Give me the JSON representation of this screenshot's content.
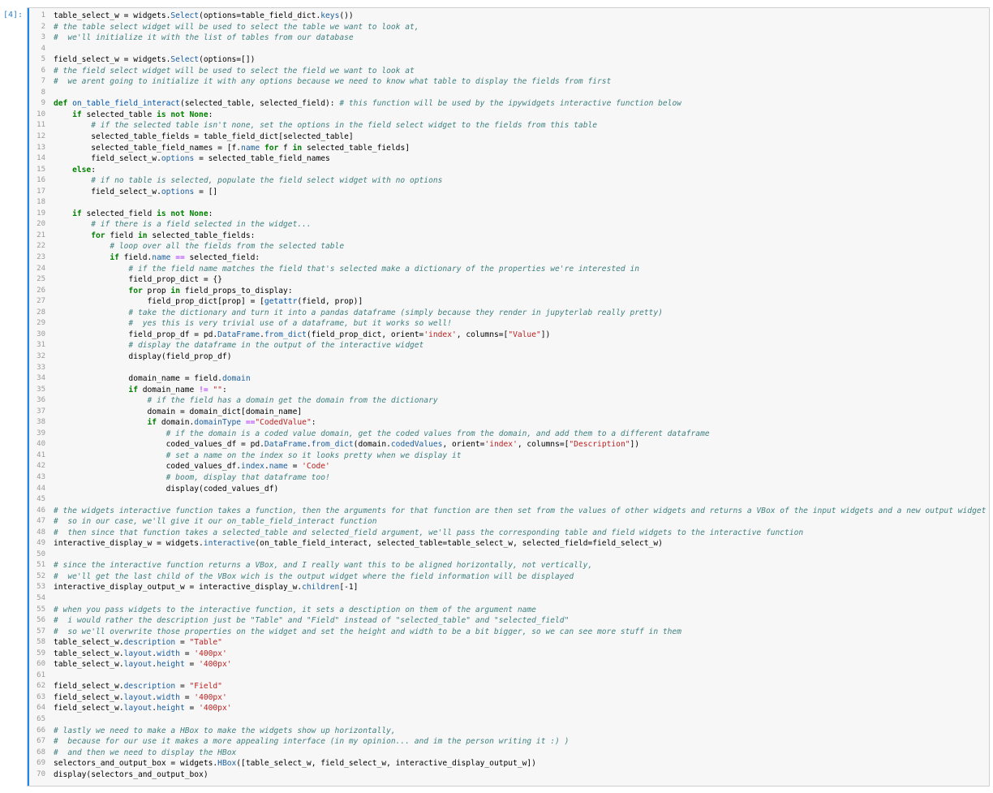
{
  "prompt": "[4]:",
  "lines": [
    [
      [
        "n",
        "table_select_w = widgets."
      ],
      [
        "at",
        "Select"
      ],
      [
        "n",
        "(options=table_field_dict."
      ],
      [
        "at",
        "keys"
      ],
      [
        "n",
        "())"
      ]
    ],
    [
      [
        "cm",
        "# the table select widget will be used to select the table we want to look at,"
      ]
    ],
    [
      [
        "cm",
        "#  we'll initialize it with the list of tables from our database"
      ]
    ],
    [
      [
        "n",
        ""
      ]
    ],
    [
      [
        "n",
        "field_select_w = widgets."
      ],
      [
        "at",
        "Select"
      ],
      [
        "n",
        "(options=[])"
      ]
    ],
    [
      [
        "cm",
        "# the field select widget will be used to select the field we want to look at"
      ]
    ],
    [
      [
        "cm",
        "#  we arent going to initialize it with any options because we need to know what table to display the fields from first"
      ]
    ],
    [
      [
        "n",
        ""
      ]
    ],
    [
      [
        "kw",
        "def "
      ],
      [
        "nb",
        "on_table_field_interact"
      ],
      [
        "n",
        "(selected_table, selected_field): "
      ],
      [
        "cm",
        "# this function will be used by the ipywidgets interactive function below"
      ]
    ],
    [
      [
        "n",
        "    "
      ],
      [
        "kw",
        "if "
      ],
      [
        "n",
        "selected_table "
      ],
      [
        "kw",
        "is not None"
      ],
      [
        "n",
        ":"
      ]
    ],
    [
      [
        "n",
        "        "
      ],
      [
        "cm",
        "# if the selected table isn't none, set the options in the field select widget to the fields from this table"
      ]
    ],
    [
      [
        "n",
        "        selected_table_fields = table_field_dict[selected_table]"
      ]
    ],
    [
      [
        "n",
        "        selected_table_field_names = [f."
      ],
      [
        "at",
        "name"
      ],
      [
        "n",
        " "
      ],
      [
        "kw",
        "for "
      ],
      [
        "n",
        "f "
      ],
      [
        "kw",
        "in "
      ],
      [
        "n",
        "selected_table_fields]"
      ]
    ],
    [
      [
        "n",
        "        field_select_w."
      ],
      [
        "at",
        "options"
      ],
      [
        "n",
        " = selected_table_field_names"
      ]
    ],
    [
      [
        "n",
        "    "
      ],
      [
        "kw",
        "else"
      ],
      [
        "n",
        ":"
      ]
    ],
    [
      [
        "n",
        "        "
      ],
      [
        "cm",
        "# if no table is selected, populate the field select widget with no options"
      ]
    ],
    [
      [
        "n",
        "        field_select_w."
      ],
      [
        "at",
        "options"
      ],
      [
        "n",
        " = []"
      ]
    ],
    [
      [
        "n",
        ""
      ]
    ],
    [
      [
        "n",
        "    "
      ],
      [
        "kw",
        "if "
      ],
      [
        "n",
        "selected_field "
      ],
      [
        "kw",
        "is not None"
      ],
      [
        "n",
        ":"
      ]
    ],
    [
      [
        "n",
        "        "
      ],
      [
        "cm",
        "# if there is a field selected in the widget..."
      ]
    ],
    [
      [
        "n",
        "        "
      ],
      [
        "kw",
        "for "
      ],
      [
        "n",
        "field "
      ],
      [
        "kw",
        "in "
      ],
      [
        "n",
        "selected_table_fields:"
      ]
    ],
    [
      [
        "n",
        "            "
      ],
      [
        "cm",
        "# loop over all the fields from the selected table"
      ]
    ],
    [
      [
        "n",
        "            "
      ],
      [
        "kw",
        "if "
      ],
      [
        "n",
        "field."
      ],
      [
        "at",
        "name"
      ],
      [
        "n",
        " "
      ],
      [
        "op",
        "=="
      ],
      [
        "n",
        " selected_field:"
      ]
    ],
    [
      [
        "n",
        "                "
      ],
      [
        "cm",
        "# if the field name matches the field that's selected make a dictionary of the properties we're interested in"
      ]
    ],
    [
      [
        "n",
        "                field_prop_dict = {}"
      ]
    ],
    [
      [
        "n",
        "                "
      ],
      [
        "kw",
        "for "
      ],
      [
        "n",
        "prop "
      ],
      [
        "kw",
        "in "
      ],
      [
        "n",
        "field_props_to_display:"
      ]
    ],
    [
      [
        "n",
        "                    field_prop_dict[prop] = ["
      ],
      [
        "nb",
        "getattr"
      ],
      [
        "n",
        "(field, prop)]"
      ]
    ],
    [
      [
        "n",
        "                "
      ],
      [
        "cm",
        "# take the dictionary and turn it into a pandas dataframe (simply because they render in jupyterlab really pretty)"
      ]
    ],
    [
      [
        "n",
        "                "
      ],
      [
        "cm",
        "#  yes this is very trivial use of a dataframe, but it works so well!"
      ]
    ],
    [
      [
        "n",
        "                field_prop_df = pd."
      ],
      [
        "at",
        "DataFrame"
      ],
      [
        "n",
        "."
      ],
      [
        "at",
        "from_dict"
      ],
      [
        "n",
        "(field_prop_dict, orient="
      ],
      [
        "st",
        "'index'"
      ],
      [
        "n",
        ", columns=["
      ],
      [
        "st",
        "\"Value\""
      ],
      [
        "n",
        "])"
      ]
    ],
    [
      [
        "n",
        "                "
      ],
      [
        "cm",
        "# display the dataframe in the output of the interactive widget"
      ]
    ],
    [
      [
        "n",
        "                display(field_prop_df)"
      ]
    ],
    [
      [
        "n",
        ""
      ]
    ],
    [
      [
        "n",
        "                domain_name = field."
      ],
      [
        "at",
        "domain"
      ]
    ],
    [
      [
        "n",
        "                "
      ],
      [
        "kw",
        "if "
      ],
      [
        "n",
        "domain_name "
      ],
      [
        "op",
        "!="
      ],
      [
        "n",
        " "
      ],
      [
        "st",
        "\"\""
      ],
      [
        "n",
        ":"
      ]
    ],
    [
      [
        "n",
        "                    "
      ],
      [
        "cm",
        "# if the field has a domain get the domain from the dictionary"
      ]
    ],
    [
      [
        "n",
        "                    domain = domain_dict[domain_name]"
      ]
    ],
    [
      [
        "n",
        "                    "
      ],
      [
        "kw",
        "if "
      ],
      [
        "n",
        "domain."
      ],
      [
        "at",
        "domainType"
      ],
      [
        "n",
        " "
      ],
      [
        "op",
        "=="
      ],
      [
        "st",
        "\"CodedValue\""
      ],
      [
        "n",
        ":"
      ]
    ],
    [
      [
        "n",
        "                        "
      ],
      [
        "cm",
        "# if the domain is a coded value domain, get the coded values from the domain, and add them to a different dataframe"
      ]
    ],
    [
      [
        "n",
        "                        coded_values_df = pd."
      ],
      [
        "at",
        "DataFrame"
      ],
      [
        "n",
        "."
      ],
      [
        "at",
        "from_dict"
      ],
      [
        "n",
        "(domain."
      ],
      [
        "at",
        "codedValues"
      ],
      [
        "n",
        ", orient="
      ],
      [
        "st",
        "'index'"
      ],
      [
        "n",
        ", columns=["
      ],
      [
        "st",
        "\"Description\""
      ],
      [
        "n",
        "])"
      ]
    ],
    [
      [
        "n",
        "                        "
      ],
      [
        "cm",
        "# set a name on the index so it looks pretty when we display it"
      ]
    ],
    [
      [
        "n",
        "                        coded_values_df."
      ],
      [
        "at",
        "index"
      ],
      [
        "n",
        "."
      ],
      [
        "at",
        "name"
      ],
      [
        "n",
        " = "
      ],
      [
        "st",
        "'Code'"
      ]
    ],
    [
      [
        "n",
        "                        "
      ],
      [
        "cm",
        "# boom, display that dataframe too!"
      ]
    ],
    [
      [
        "n",
        "                        display(coded_values_df)"
      ]
    ],
    [
      [
        "n",
        ""
      ]
    ],
    [
      [
        "cm",
        "# the widgets interactive function takes a function, then the arguments for that function are then set from the values of other widgets and returns a VBox of the input widgets and a new output widget"
      ]
    ],
    [
      [
        "cm",
        "#  so in our case, we'll give it our on_table_field_interact function"
      ]
    ],
    [
      [
        "cm",
        "#  then since that function takes a selected_table and selected_field argument, we'll pass the corresponding table and field widgets to the interactive function"
      ]
    ],
    [
      [
        "n",
        "interactive_display_w = widgets."
      ],
      [
        "at",
        "interactive"
      ],
      [
        "n",
        "(on_table_field_interact, selected_table=table_select_w, selected_field=field_select_w)"
      ]
    ],
    [
      [
        "n",
        ""
      ]
    ],
    [
      [
        "cm",
        "# since the interactive function returns a VBox, and I really want this to be aligned horizontally, not vertically,"
      ]
    ],
    [
      [
        "cm",
        "#  we'll get the last child of the VBox wich is the output widget where the field information will be displayed"
      ]
    ],
    [
      [
        "n",
        "interactive_display_output_w = interactive_display_w."
      ],
      [
        "at",
        "children"
      ],
      [
        "n",
        "[-1]"
      ]
    ],
    [
      [
        "n",
        ""
      ]
    ],
    [
      [
        "cm",
        "# when you pass widgets to the interactive function, it sets a desctiption on them of the argument name"
      ]
    ],
    [
      [
        "cm",
        "#  i would rather the description just be \"Table\" and \"Field\" instead of \"selected_table\" and \"selected_field\""
      ]
    ],
    [
      [
        "cm",
        "#  so we'll overwrite those properties on the widget and set the height and width to be a bit bigger, so we can see more stuff in them"
      ]
    ],
    [
      [
        "n",
        "table_select_w."
      ],
      [
        "at",
        "description"
      ],
      [
        "n",
        " = "
      ],
      [
        "st",
        "\"Table\""
      ]
    ],
    [
      [
        "n",
        "table_select_w."
      ],
      [
        "at",
        "layout"
      ],
      [
        "n",
        "."
      ],
      [
        "at",
        "width"
      ],
      [
        "n",
        " = "
      ],
      [
        "st",
        "'400px'"
      ]
    ],
    [
      [
        "n",
        "table_select_w."
      ],
      [
        "at",
        "layout"
      ],
      [
        "n",
        "."
      ],
      [
        "at",
        "height"
      ],
      [
        "n",
        " = "
      ],
      [
        "st",
        "'400px'"
      ]
    ],
    [
      [
        "n",
        ""
      ]
    ],
    [
      [
        "n",
        "field_select_w."
      ],
      [
        "at",
        "description"
      ],
      [
        "n",
        " = "
      ],
      [
        "st",
        "\"Field\""
      ]
    ],
    [
      [
        "n",
        "field_select_w."
      ],
      [
        "at",
        "layout"
      ],
      [
        "n",
        "."
      ],
      [
        "at",
        "width"
      ],
      [
        "n",
        " = "
      ],
      [
        "st",
        "'400px'"
      ]
    ],
    [
      [
        "n",
        "field_select_w."
      ],
      [
        "at",
        "layout"
      ],
      [
        "n",
        "."
      ],
      [
        "at",
        "height"
      ],
      [
        "n",
        " = "
      ],
      [
        "st",
        "'400px'"
      ]
    ],
    [
      [
        "n",
        ""
      ]
    ],
    [
      [
        "cm",
        "# lastly we need to make a HBox to make the widgets show up horizontally,"
      ]
    ],
    [
      [
        "cm",
        "#  because for our use it makes a more appealing interface (in my opinion... and im the person writing it :) )"
      ]
    ],
    [
      [
        "cm",
        "#  and then we need to display the HBox"
      ]
    ],
    [
      [
        "n",
        "selectors_and_output_box = widgets."
      ],
      [
        "at",
        "HBox"
      ],
      [
        "n",
        "([table_select_w, field_select_w, interactive_display_output_w])"
      ]
    ],
    [
      [
        "n",
        "display(selectors_and_output_box)"
      ]
    ]
  ]
}
